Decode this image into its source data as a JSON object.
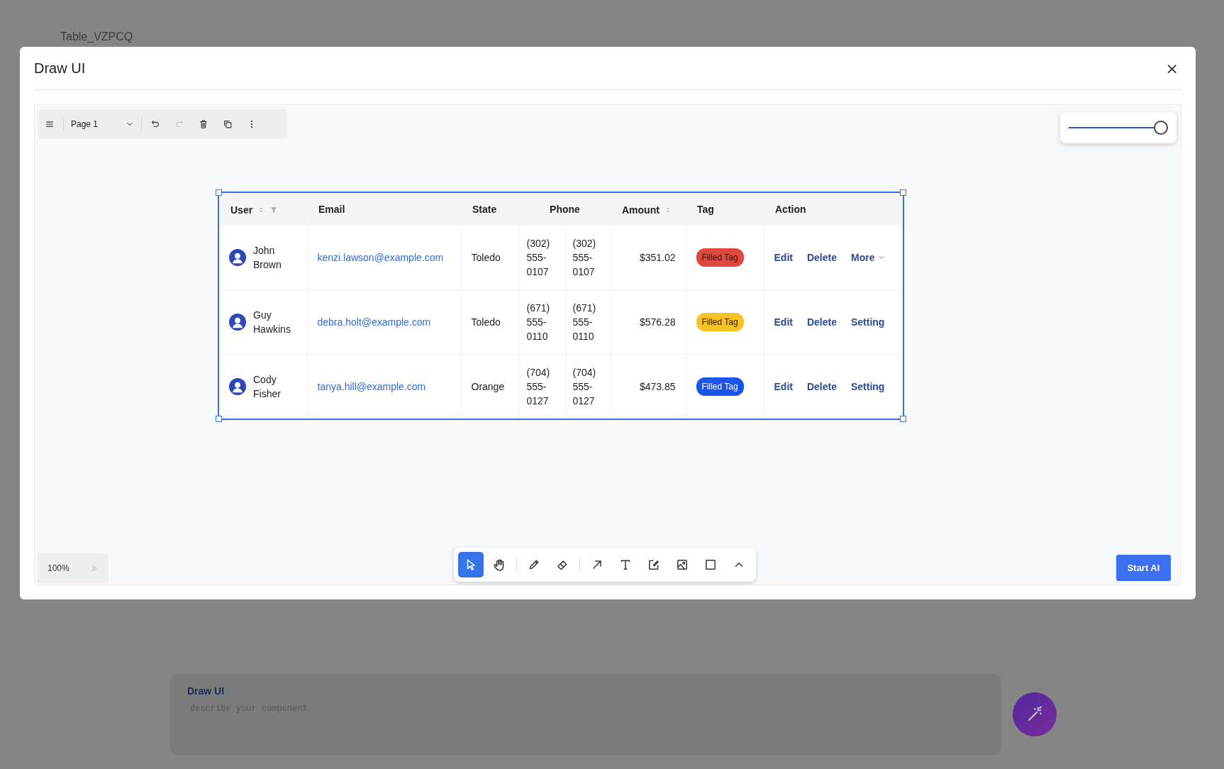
{
  "background": {
    "page_title": "Table_VZPCQ",
    "prompt_panel": {
      "title": "Draw UI",
      "placeholder": "describe your component"
    }
  },
  "dialog": {
    "title": "Draw UI",
    "close": "×"
  },
  "page_toolbar": {
    "page_select": "Page 1",
    "redo_disabled": true
  },
  "zoom_slider": {
    "level": 1
  },
  "table": {
    "columns": [
      {
        "label": "User",
        "kind": "single",
        "sortable": true,
        "filterable": true
      },
      {
        "label": "Email",
        "kind": "single",
        "sortable": false,
        "filterable": false
      },
      {
        "label": "State",
        "kind": "single",
        "sortable": false,
        "filterable": false
      },
      {
        "label": "Phone",
        "kind": "paired",
        "sortable": false,
        "filterable": false
      },
      {
        "label": "Amount",
        "kind": "single",
        "sortable": true,
        "filterable": false
      },
      {
        "label": "Tag",
        "kind": "single",
        "sortable": false,
        "filterable": false
      },
      {
        "label": "Action",
        "kind": "single",
        "sortable": false,
        "filterable": false
      }
    ],
    "rows": [
      {
        "user": "John Brown",
        "email": "kenzi.lawson@example.com",
        "state": "Toledo",
        "phone": [
          "(302) 555-0107",
          "(302) 555-0107"
        ],
        "amount": "$351.02",
        "tag": {
          "label": "Filled Tag",
          "color": "#e0483e"
        },
        "actions": [
          {
            "label": "Edit",
            "kind": "link"
          },
          {
            "label": "Delete",
            "kind": "link"
          },
          {
            "label": "More",
            "kind": "dropdown"
          }
        ]
      },
      {
        "user": "Guy Hawkins",
        "email": "debra.holt@example.com",
        "state": "Toledo",
        "phone": [
          "(671) 555-0110",
          "(671) 555-0110"
        ],
        "amount": "$576.28",
        "tag": {
          "label": "Filled Tag",
          "color": "#f6c325"
        },
        "actions": [
          {
            "label": "Edit",
            "kind": "link"
          },
          {
            "label": "Delete",
            "kind": "link"
          },
          {
            "label": "Setting",
            "kind": "link"
          }
        ]
      },
      {
        "user": "Cody Fisher",
        "email": "tanya.hill@example.com",
        "state": "Orange",
        "phone": [
          "(704) 555-0127",
          "(704) 555-0127"
        ],
        "amount": "$473.85",
        "tag": {
          "label": "Filled Tag",
          "color": "#1a54e8"
        },
        "actions": [
          {
            "label": "Edit",
            "kind": "link"
          },
          {
            "label": "Delete",
            "kind": "link"
          },
          {
            "label": "Setting",
            "kind": "link"
          }
        ]
      }
    ]
  },
  "zoom_indicator": "100%",
  "drawing_tool_groups": [
    {
      "tools": [
        {
          "kind": "select",
          "selected": true
        },
        {
          "kind": "hand",
          "selected": false
        }
      ]
    },
    {
      "tools": [
        {
          "kind": "pencil",
          "selected": false
        },
        {
          "kind": "eraser",
          "selected": false
        }
      ]
    },
    {
      "tools": [
        {
          "kind": "arrow",
          "selected": false
        },
        {
          "kind": "text",
          "selected": false
        },
        {
          "kind": "note",
          "selected": false
        },
        {
          "kind": "image",
          "selected": false
        },
        {
          "kind": "rectangle",
          "selected": false
        },
        {
          "kind": "expand",
          "selected": false
        }
      ]
    }
  ],
  "start_button": "Start AI"
}
